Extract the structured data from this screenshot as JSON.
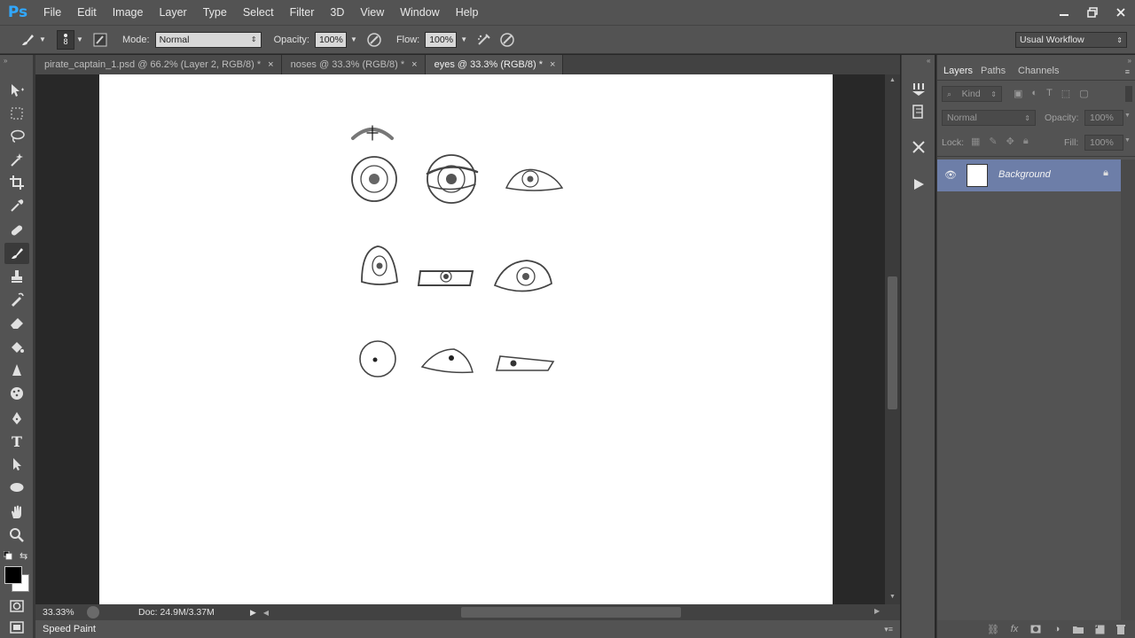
{
  "app": {
    "logo": "Ps"
  },
  "menu": [
    "File",
    "Edit",
    "Image",
    "Layer",
    "Type",
    "Select",
    "Filter",
    "3D",
    "View",
    "Window",
    "Help"
  ],
  "options": {
    "brush_size": "8",
    "mode_label": "Mode:",
    "mode_value": "Normal",
    "opacity_label": "Opacity:",
    "opacity_value": "100%",
    "flow_label": "Flow:",
    "flow_value": "100%",
    "workspace": "Usual Workflow"
  },
  "tabs": [
    {
      "label": "pirate_captain_1.psd @ 66.2% (Layer 2, RGB/8) *",
      "close": "×"
    },
    {
      "label": "noses @ 33.3% (RGB/8) *",
      "close": "×"
    },
    {
      "label": "eyes @ 33.3% (RGB/8) *",
      "close": "×"
    }
  ],
  "status": {
    "zoom": "33.33%",
    "doc": "Doc: 24.9M/3.37M"
  },
  "bottom": {
    "label": "Speed Paint"
  },
  "layers_panel": {
    "tabs": [
      "Layers",
      "Paths",
      "Channels"
    ],
    "kind_label": "Kind",
    "blend_mode": "Normal",
    "opacity_label": "Opacity:",
    "opacity_value": "100%",
    "lock_label": "Lock:",
    "fill_label": "Fill:",
    "fill_value": "100%",
    "layer_name": "Background"
  },
  "colors": {
    "accent": "#31a8ff",
    "selected_layer": "#6d7ea8",
    "ui_dark": "#535353",
    "canvas_bg": "#282828"
  }
}
